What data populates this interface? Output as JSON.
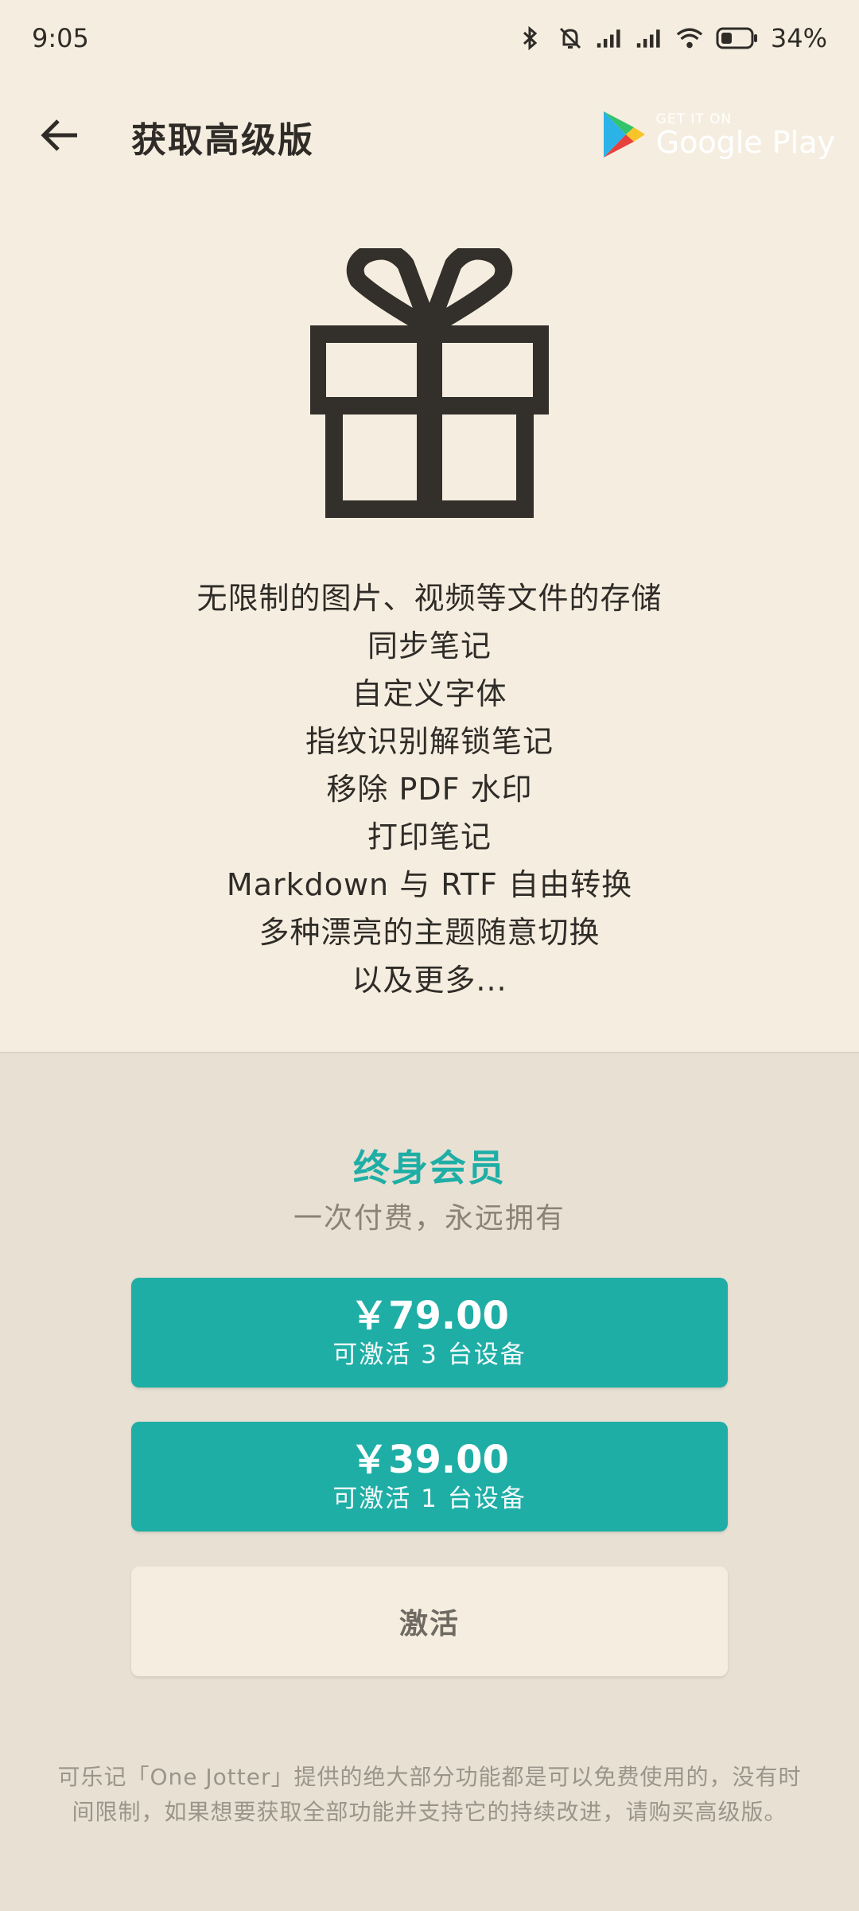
{
  "status": {
    "time": "9:05",
    "battery": "34%",
    "icons": [
      "bluetooth-icon",
      "mute-icon",
      "signal-icon",
      "signal-icon",
      "wifi-icon",
      "battery-icon"
    ]
  },
  "appbar": {
    "title": "获取高级版",
    "store_badge_top": "GET IT ON",
    "store_badge_name": "Google Play"
  },
  "features": [
    "无限制的图片、视频等文件的存储",
    "同步笔记",
    "自定义字体",
    "指纹识别解锁笔记",
    "移除 PDF 水印",
    "打印笔记",
    "Markdown 与 RTF 自由转换",
    "多种漂亮的主题随意切换",
    "以及更多..."
  ],
  "plan": {
    "title": "终身会员",
    "subtitle": "一次付费，永远拥有",
    "options": [
      {
        "price": "￥79.00",
        "note": "可激活 3 台设备"
      },
      {
        "price": "￥39.00",
        "note": "可激活 1 台设备"
      }
    ],
    "activate_label": "激活",
    "disclaimer": "可乐记「One Jotter」提供的绝大部分功能都是可以免费使用的，没有时间限制，如果想要获取全部功能并支持它的持续改进，请购买高级版。"
  },
  "colors": {
    "background": "#f5eee0",
    "panel": "#e8e0d3",
    "accent": "#1eaea6",
    "text": "#2f2c28"
  }
}
